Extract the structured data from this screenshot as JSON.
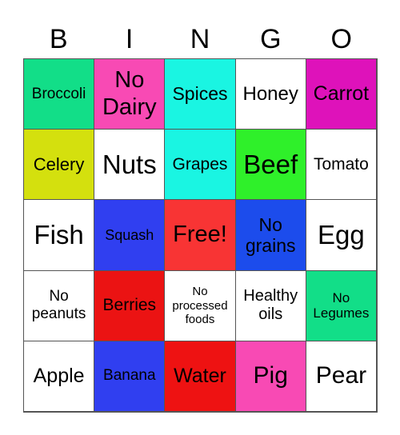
{
  "header": {
    "letters": [
      "B",
      "I",
      "N",
      "G",
      "O"
    ]
  },
  "cells": [
    {
      "text": "Broccoli",
      "bg": "#12DE88",
      "size": 19
    },
    {
      "text": "No Dairy",
      "bg": "#F84AB4",
      "size": 29
    },
    {
      "text": "Spices",
      "bg": "#1AF5E2",
      "size": 23
    },
    {
      "text": "Honey",
      "bg": "#FFFFFF",
      "size": 24
    },
    {
      "text": "Carrot",
      "bg": "#DE12BA",
      "size": 25
    },
    {
      "text": "Celery",
      "bg": "#D4E00E",
      "size": 22
    },
    {
      "text": "Nuts",
      "bg": "#FFFFFF",
      "size": 33
    },
    {
      "text": "Grapes",
      "bg": "#1AF5E2",
      "size": 21
    },
    {
      "text": "Beef",
      "bg": "#2FF02A",
      "size": 33
    },
    {
      "text": "Tomato",
      "bg": "#FFFFFF",
      "size": 21
    },
    {
      "text": "Fish",
      "bg": "#FFFFFF",
      "size": 33
    },
    {
      "text": "Squash",
      "bg": "#303FF0",
      "size": 18
    },
    {
      "text": "Free!",
      "bg": "#F83434",
      "size": 29
    },
    {
      "text": "No grains",
      "bg": "#1C4CEC",
      "size": 23
    },
    {
      "text": "Egg",
      "bg": "#FFFFFF",
      "size": 33
    },
    {
      "text": "No peanuts",
      "bg": "#FFFFFF",
      "size": 19
    },
    {
      "text": "Berries",
      "bg": "#EB1313",
      "size": 21
    },
    {
      "text": "No processed foods",
      "bg": "#FFFFFF",
      "size": 15
    },
    {
      "text": "Healthy oils",
      "bg": "#FFFFFF",
      "size": 20
    },
    {
      "text": "No Legumes",
      "bg": "#12DE88",
      "size": 17
    },
    {
      "text": "Apple",
      "bg": "#FFFFFF",
      "size": 25
    },
    {
      "text": "Banana",
      "bg": "#303FF0",
      "size": 19
    },
    {
      "text": "Water",
      "bg": "#EE1212",
      "size": 25
    },
    {
      "text": "Pig",
      "bg": "#F84AB4",
      "size": 30
    },
    {
      "text": "Pear",
      "bg": "#FFFFFF",
      "size": 30
    }
  ]
}
